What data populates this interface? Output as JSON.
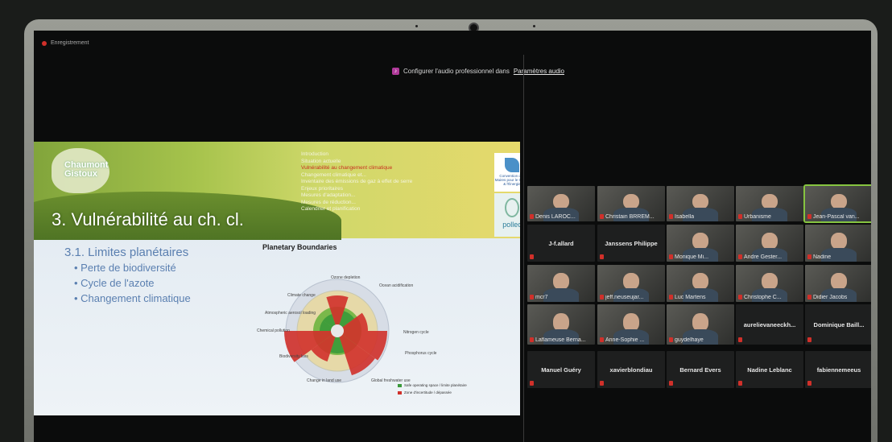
{
  "recording": {
    "label": "Enregistrement"
  },
  "banner": {
    "text": "Configurer l'audio professionnel dans",
    "link": "Paramètres audio"
  },
  "slide": {
    "logo_line1": "Chaumont",
    "logo_line2": "Gistoux",
    "title": "3. Vulnérabilité au ch. cl.",
    "agenda": [
      "Introduction",
      "Situation actuelle",
      "Vulnérabilité au changement climatique",
      "Changement climatique et...",
      "Inventaire des émissions de gaz à effet de serre",
      "Enjeux prioritaires",
      "Mesures d'adaptation...",
      "Mesures de réduction...",
      "Calendrier et planification"
    ],
    "agenda_active_index": 2,
    "partner_label": "Convention des Maires pour le Climat & l'Énergie",
    "pollec": "pollec",
    "bullets": {
      "heading": "3.1. Limites planétaires",
      "items": [
        "Perte de biodiversité",
        "Cycle de l'azote",
        "Changement climatique"
      ]
    },
    "chart": {
      "title": "Planetary Boundaries",
      "labels": [
        "Climate change",
        "Ozone depletion",
        "Ocean acidification",
        "Nitrogen cycle",
        "Phosphorus cycle",
        "Global freshwater use",
        "Change in land use",
        "Biodiversity loss",
        "Chemical pollution",
        "Atmospheric aerosol loading"
      ],
      "legend": [
        "Safe operating space / limite planétaire",
        "Zone d'incertitude / dépassée"
      ],
      "colors": {
        "safe": "#3a9a3a",
        "exceeded": "#d0302a"
      }
    }
  },
  "gallery": {
    "row1": [
      {
        "name": "Denis LAROC...",
        "type": "video"
      },
      {
        "name": "Christain BRREM...",
        "type": "video"
      },
      {
        "name": "Isabella",
        "type": "video"
      },
      {
        "name": "Urbanisme",
        "type": "video"
      },
      {
        "name": "Jean-Pascal van...",
        "type": "video",
        "active": true
      }
    ],
    "row2": [
      {
        "name": "J-f.allard",
        "type": "name"
      },
      {
        "name": "Janssens Philippe",
        "type": "name"
      },
      {
        "name": "Monique Mi...",
        "type": "video"
      },
      {
        "name": "Andre Gester...",
        "type": "video"
      },
      {
        "name": "Nadine",
        "type": "video"
      }
    ],
    "row3": [
      {
        "name": "mcr7",
        "type": "video"
      },
      {
        "name": "jeff.neuseujar...",
        "type": "video"
      },
      {
        "name": "Luc Martens",
        "type": "video"
      },
      {
        "name": "Christophe C...",
        "type": "video"
      },
      {
        "name": "Didier Jacobs",
        "type": "video"
      }
    ],
    "row4": [
      {
        "name": "Laflameuse Berna...",
        "type": "video"
      },
      {
        "name": "Anne-Sophie ...",
        "type": "video"
      },
      {
        "name": "guydelhaye",
        "type": "video"
      },
      {
        "name": "aurelievaneeckh...",
        "type": "name"
      },
      {
        "name": "Dominique  Baill...",
        "type": "name"
      }
    ],
    "row5": [
      {
        "name": "Manuel Guéry",
        "type": "name"
      },
      {
        "name": "xavierblondiau",
        "type": "name"
      },
      {
        "name": "Bernard Evers",
        "type": "name"
      },
      {
        "name": "Nadine Leblanc",
        "type": "name"
      },
      {
        "name": "fabiennemeeus",
        "type": "name"
      }
    ]
  }
}
